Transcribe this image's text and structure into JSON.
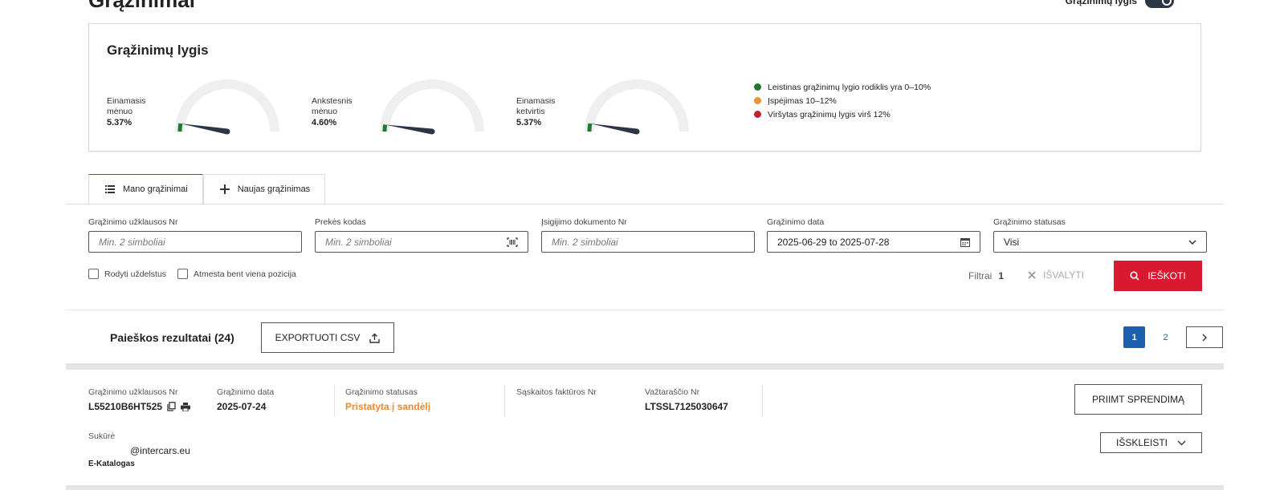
{
  "page": {
    "title": "Grąžinimai",
    "toggle_label": "Grąžinimų lygis"
  },
  "rate_card": {
    "title": "Grąžinimų lygis",
    "gauges": [
      {
        "label_line1": "Einamasis",
        "label_line2": "mėnuo",
        "value": "5.37%",
        "percent": 5.37
      },
      {
        "label_line1": "Ankstesnis",
        "label_line2": "mėnuo",
        "value": "4.60%",
        "percent": 4.6
      },
      {
        "label_line1": "Einamasis",
        "label_line2": "ketvirtis",
        "value": "5.37%",
        "percent": 5.37
      }
    ],
    "legend": [
      {
        "text": "Leistinas grąžinimų lygio rodiklis yra 0–10%",
        "color": "#1e7a2f"
      },
      {
        "text": "Įspėjimas 10–12%",
        "color": "#e8962e"
      },
      {
        "text": "Viršytas grąžinimų lygis virš 12%",
        "color": "#c0222f"
      }
    ]
  },
  "tabs": [
    {
      "label": "Mano grąžinimai",
      "icon": "list-icon",
      "active": true
    },
    {
      "label": "Naujas grąžinimas",
      "icon": "plus-icon",
      "active": false
    }
  ],
  "filters": {
    "request_no": {
      "label": "Grąžinimo užklausos Nr",
      "placeholder": "Min. 2 simboliai"
    },
    "product_code": {
      "label": "Prekės kodas",
      "placeholder": "Min. 2 simboliai",
      "icon": "barcode-scan-icon"
    },
    "purchase_doc": {
      "label": "Įsigijimo dokumento Nr",
      "placeholder": "Min. 2 simboliai"
    },
    "return_date": {
      "label": "Grąžinimo data",
      "value": "2025-06-29 to 2025-07-28",
      "icon": "calendar-icon"
    },
    "status": {
      "label": "Grąžinimo statusas",
      "value": "Visi",
      "icon": "chevron-down-icon"
    },
    "show_delayed": "Rodyti uždelstus",
    "rejected_one": "Atmesta bent viena pozicija",
    "filters_label": "Filtrai",
    "filters_count": "1",
    "clear_label": "IŠVALYTI",
    "search_label": "IEŠKOTI"
  },
  "results": {
    "title": "Paieškos rezultatai (24)",
    "export_label": "EXPORTUOTI CSV",
    "pages": [
      "1",
      "2"
    ],
    "current_page": "1"
  },
  "result_item": {
    "request_no_label": "Grąžinimo užklausos Nr",
    "request_no": "L55210B6HT525",
    "date_label": "Grąžinimo data",
    "date": "2025-07-24",
    "status_label": "Grąžinimo statusas",
    "status": "Pristatyta į sandėlį",
    "status_color": "#f0882d",
    "invoice_label": "Sąskaitos faktūros Nr",
    "invoice": "",
    "waybill_label": "Važtaraščio Nr",
    "waybill": "LTSSL7125030647",
    "decision_label": "PRIIMT SPRENDIMĄ",
    "expand_label": "IŠSKLEISTI",
    "created_by_label": "Sukūrė",
    "created_by_email": "@intercars.eu",
    "created_by_source": "E-Katalogas"
  }
}
